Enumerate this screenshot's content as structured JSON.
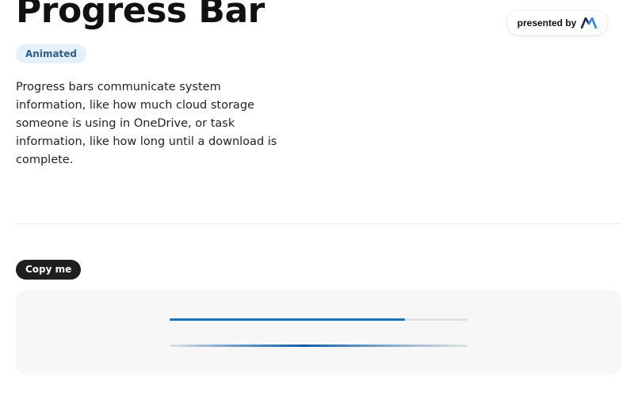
{
  "header": {
    "title": "Progress Bar",
    "badge": "Animated",
    "presented_by": "presented by",
    "logo_icon": "brand-logo-icon"
  },
  "description": "Progress bars communicate system information, like how much cloud storage someone is using in OneDrive, or task information, like how long until a download is complete.",
  "actions": {
    "copy_label": "Copy me"
  },
  "demo": {
    "determinate_progress": 0.79,
    "indeterminate": true
  },
  "colors": {
    "accent": "#1f6fb5",
    "track": "#e1e1e1",
    "badge_bg": "#e6f0fa",
    "badge_text": "#2d5f8c",
    "button_bg": "#1f1f1f"
  }
}
